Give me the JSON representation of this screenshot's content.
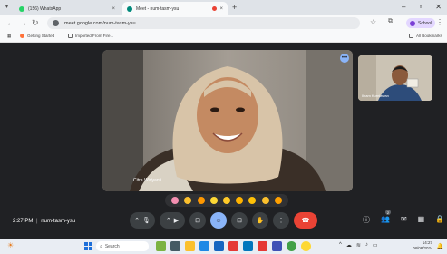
{
  "browser": {
    "tabs": [
      {
        "label": "(156) WhatsApp",
        "icon": "whatsapp-icon",
        "color": "#25d366"
      },
      {
        "label": "Meet - num-tasm-ysu",
        "icon": "meet-icon",
        "color": "#00897b"
      }
    ],
    "address": "meet.google.com/num-tasm-ysu",
    "profile_label": "School",
    "bookmarks": [
      {
        "label": "Getting Started",
        "icon": "firefox-icon"
      },
      {
        "label": "Imported From Fire...",
        "icon": "folder-icon"
      }
    ],
    "all_bookmarks": "All Bookmarks"
  },
  "meet": {
    "main_participant": "Citra Widyanti",
    "self_participant": "Ilham Kurniawan",
    "time": "2:27 PM",
    "separator": "|",
    "meeting_code": "num-tasm-ysu",
    "reactions": [
      "sparkling-heart",
      "thumbs-up",
      "party-popper",
      "clapping-hands",
      "joy",
      "open-mouth",
      "slightly-frowning",
      "thinking",
      "thumbs-down"
    ],
    "controls": [
      "more-options",
      "microphone",
      "camera",
      "captions",
      "emoji",
      "present",
      "raise-hand",
      "more-vert",
      "end-call"
    ],
    "people_count": "2"
  },
  "taskbar": {
    "search_label": "Search",
    "time": "14:27",
    "date": "08/08/2024"
  },
  "colors": {
    "meet_bg": "#202124",
    "end_call": "#ea4335",
    "active": "#8ab4f8"
  }
}
